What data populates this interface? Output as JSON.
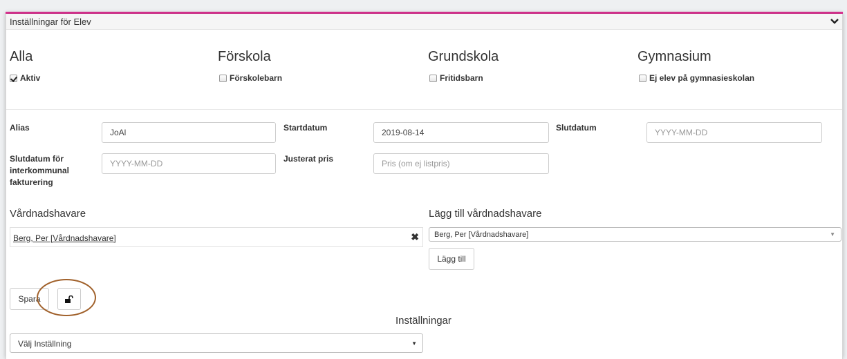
{
  "panel": {
    "title": "Inställningar för Elev"
  },
  "categories": [
    {
      "heading": "Alla",
      "checkbox_label": "Aktiv",
      "checked": true
    },
    {
      "heading": "Förskola",
      "checkbox_label": "Förskolebarn",
      "checked": false
    },
    {
      "heading": "Grundskola",
      "checkbox_label": "Fritidsbarn",
      "checked": false
    },
    {
      "heading": "Gymnasium",
      "checkbox_label": "Ej elev på gymnasieskolan",
      "checked": false
    }
  ],
  "fields": {
    "alias": {
      "label": "Alias",
      "value": "JoAl",
      "placeholder": ""
    },
    "startdatum": {
      "label": "Startdatum",
      "value": "2019-08-14",
      "placeholder": ""
    },
    "slutdatum": {
      "label": "Slutdatum",
      "value": "",
      "placeholder": "YYYY-MM-DD"
    },
    "interkommunal": {
      "label": "Slutdatum för interkommunal fakturering",
      "value": "",
      "placeholder": "YYYY-MM-DD"
    },
    "justerat_pris": {
      "label": "Justerat pris",
      "value": "",
      "placeholder": "Pris (om ej listpris)"
    }
  },
  "guardians": {
    "heading": "Vårdnadshavare",
    "selected": "Berg, Per [Vårdnadshavare]",
    "remove_symbol": "✖"
  },
  "add_guardian": {
    "heading": "Lägg till vårdnadshavare",
    "selected": "Berg, Per [Vårdnadshavare]",
    "button_label": "Lägg till"
  },
  "actions": {
    "save_label": "Spara"
  },
  "settings": {
    "heading": "Inställningar",
    "selected": "Välj Inställning"
  },
  "colors": {
    "accent_line": "#e8359a",
    "annotation_circle": "#a0602a"
  }
}
